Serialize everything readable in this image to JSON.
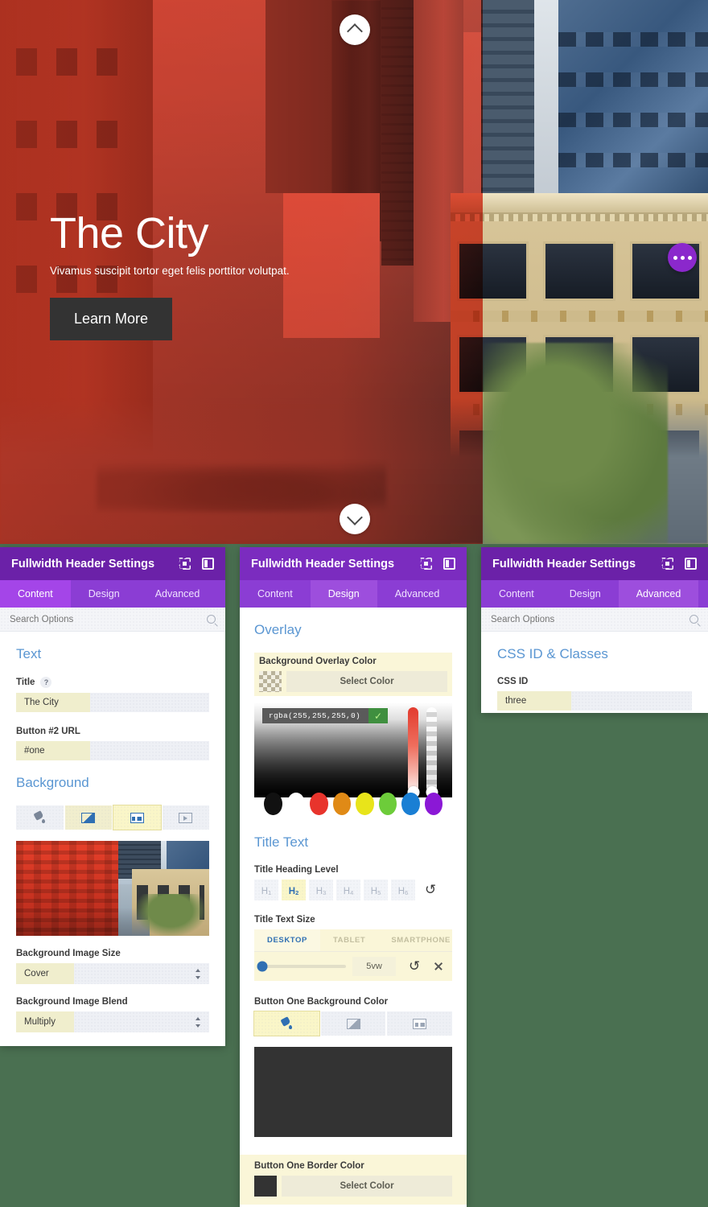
{
  "hero": {
    "title": "The City",
    "subtitle": "Vivamus suscipit tortor eget felis porttitor volutpat.",
    "button_label": "Learn More",
    "scroll_up_icon": "chevron-up-icon",
    "scroll_down_icon": "chevron-down-icon",
    "more_icon": "ellipsis-icon",
    "overlay_color": "#e8402a",
    "button_bg": "#333333"
  },
  "panels": [
    {
      "title": "Fullwidth Header Settings",
      "header_icons": [
        "focus-mode-icon",
        "panel-layout-icon"
      ],
      "tabs": [
        {
          "label": "Content",
          "active": true
        },
        {
          "label": "Design",
          "active": false
        },
        {
          "label": "Advanced",
          "active": false
        }
      ],
      "search_placeholder": "Search Options",
      "sections": [
        {
          "heading": "Text",
          "fields": [
            {
              "label": "Title",
              "has_help": true,
              "value": "The City"
            },
            {
              "label": "Button #2 URL",
              "has_help": false,
              "value": "#one"
            }
          ]
        },
        {
          "heading": "Background",
          "bg_type_buttons": [
            {
              "icon": "paint-bucket-icon",
              "state": "inactive"
            },
            {
              "icon": "gradient-icon",
              "state": "tinted"
            },
            {
              "icon": "image-icon",
              "state": "active"
            },
            {
              "icon": "video-icon",
              "state": "inactive"
            }
          ],
          "selects": [
            {
              "label": "Background Image Size",
              "value": "Cover"
            },
            {
              "label": "Background Image Blend",
              "value": "Multiply"
            }
          ]
        }
      ]
    },
    {
      "title": "Fullwidth Header Settings",
      "header_icons": [
        "focus-mode-icon",
        "panel-layout-icon"
      ],
      "tabs": [
        {
          "label": "Content",
          "active": false
        },
        {
          "label": "Design",
          "active": true
        },
        {
          "label": "Advanced",
          "active": false
        }
      ],
      "overlay_heading": "Overlay",
      "overlay_color_label": "Background Overlay Color",
      "select_color_label": "Select Color",
      "picker": {
        "value": "rgba(255,255,255,0)",
        "confirm_icon": "check-icon",
        "presets": [
          "#111111",
          "#ffffff",
          "#e8342c",
          "#e08a16",
          "#e8e41a",
          "#6dcc3a",
          "#1a7fd4",
          "#8b18d6"
        ]
      },
      "title_text_heading": "Title Text",
      "heading_level_label": "Title Heading Level",
      "heading_levels": [
        {
          "label": "H",
          "sub": "1",
          "active": false
        },
        {
          "label": "H",
          "sub": "2",
          "active": true
        },
        {
          "label": "H",
          "sub": "3",
          "active": false
        },
        {
          "label": "H",
          "sub": "4",
          "active": false
        },
        {
          "label": "H",
          "sub": "5",
          "active": false
        },
        {
          "label": "H",
          "sub": "6",
          "active": false
        }
      ],
      "reset_icon": "reset-icon",
      "text_size_label": "Title Text Size",
      "responsive_tabs": [
        {
          "label": "DESKTOP",
          "active": true
        },
        {
          "label": "TABLET",
          "active": false
        },
        {
          "label": "SMARTPHONE",
          "active": false
        }
      ],
      "text_size_value": "5vw",
      "button_bg_label": "Button One Background Color",
      "button_bg_type_buttons": [
        {
          "icon": "paint-bucket-icon",
          "state": "active"
        },
        {
          "icon": "gradient-icon",
          "state": "inactive"
        },
        {
          "icon": "image-icon",
          "state": "inactive"
        }
      ],
      "button_bg_color": "#333333",
      "button_border_label": "Button One Border Color",
      "button_border_color": "#333333",
      "button_border_select_label": "Select Color"
    },
    {
      "title": "Fullwidth Header Settings",
      "header_icons": [
        "focus-mode-icon",
        "panel-layout-icon"
      ],
      "tabs": [
        {
          "label": "Content",
          "active": false
        },
        {
          "label": "Design",
          "active": false
        },
        {
          "label": "Advanced",
          "active": true
        }
      ],
      "search_placeholder": "Search Options",
      "heading": "CSS ID & Classes",
      "field_label": "CSS ID",
      "field_value": "three"
    }
  ],
  "theme": {
    "header_purple": "#6b21a8",
    "tab_purple": "#8b3dd4",
    "tab_active_purple": "#9d4edd",
    "section_blue": "#5a96d2",
    "highlight_yellow": "#f0eecd",
    "page_green": "#4a7051"
  }
}
